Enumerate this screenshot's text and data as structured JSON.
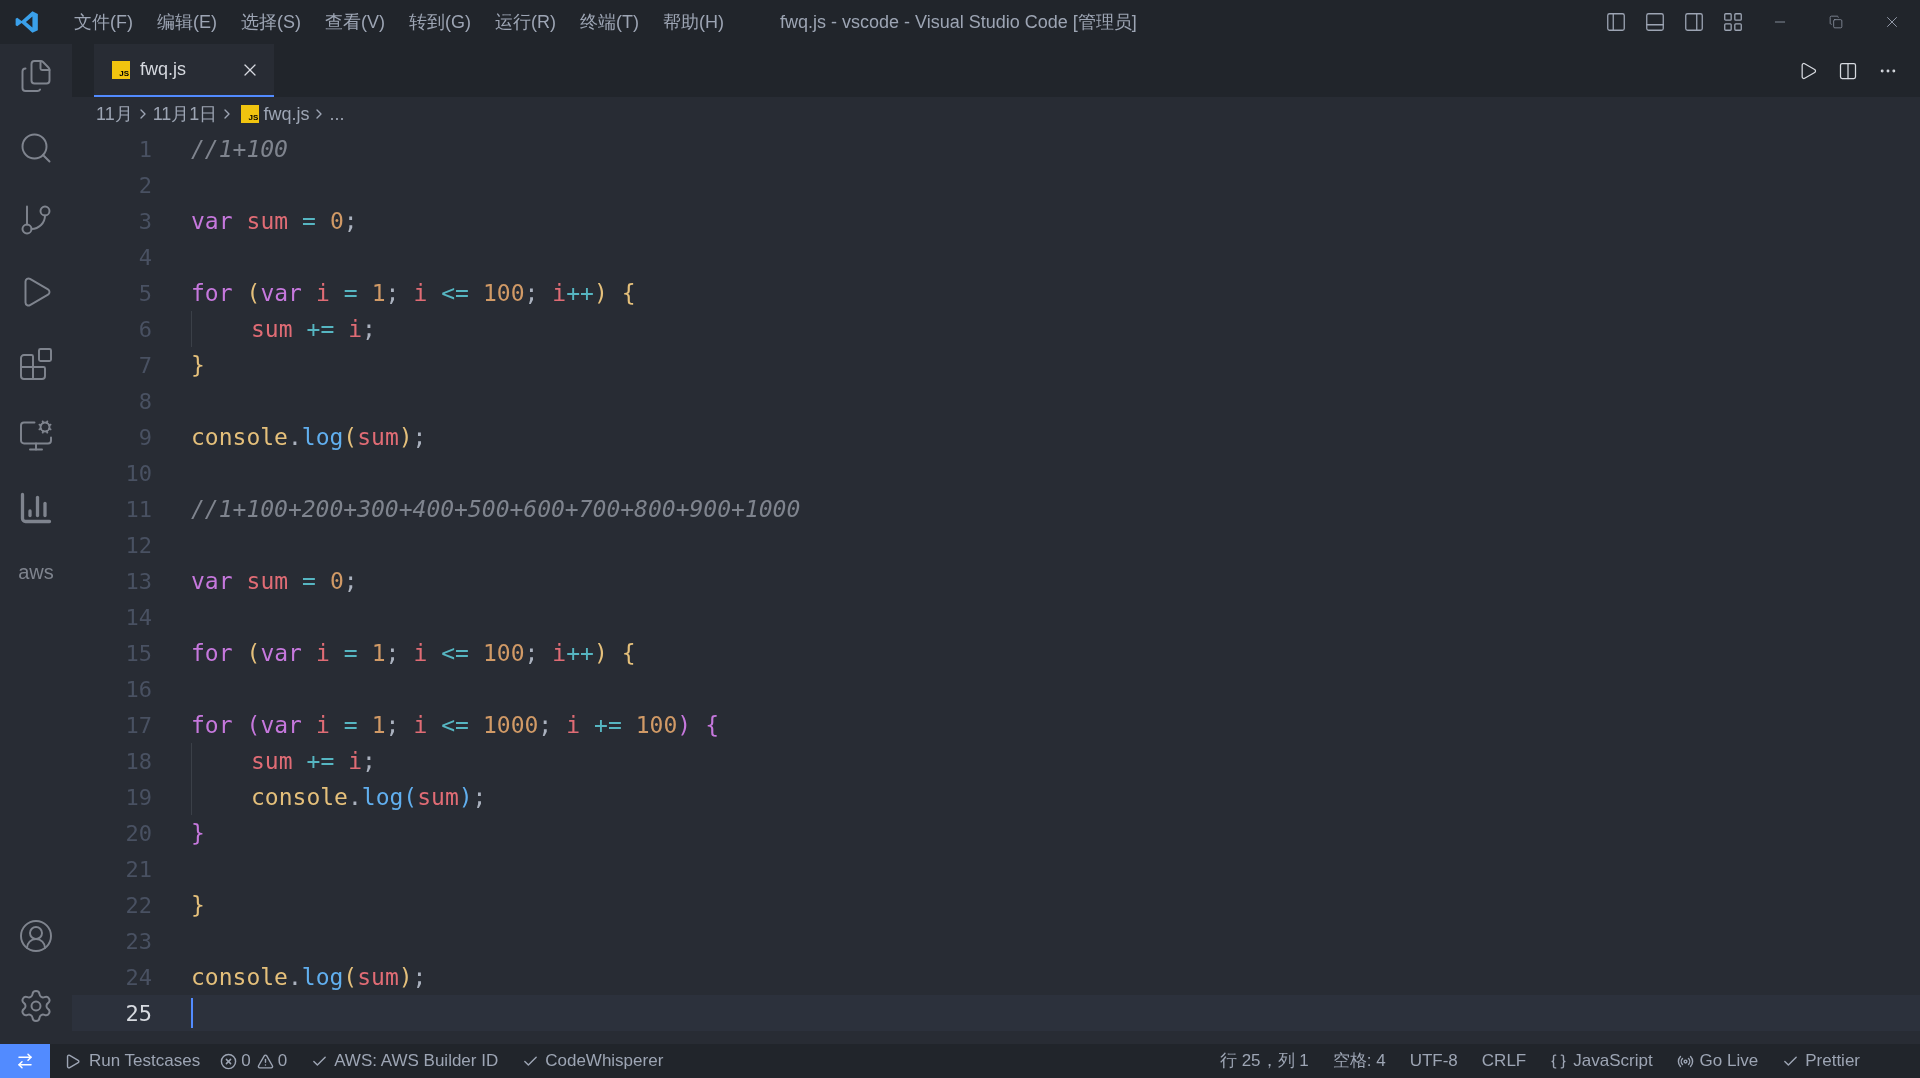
{
  "title_bar": {
    "menus": [
      "文件(F)",
      "编辑(E)",
      "选择(S)",
      "查看(V)",
      "转到(G)",
      "运行(R)",
      "终端(T)",
      "帮助(H)"
    ],
    "title": "fwq.js - vscode - Visual Studio Code [管理员]"
  },
  "activity_bar": {
    "items": [
      {
        "kind": "files",
        "selected": false
      },
      {
        "kind": "search",
        "selected": false
      },
      {
        "kind": "git",
        "selected": false
      },
      {
        "kind": "debug",
        "selected": false
      },
      {
        "kind": "extensions",
        "selected": false
      },
      {
        "kind": "remote",
        "selected": false
      },
      {
        "kind": "chart",
        "selected": false
      },
      {
        "kind": "aws",
        "selected": false
      }
    ],
    "aws_label": "aws"
  },
  "tabs": [
    {
      "badge": "JS",
      "label": "fwq.js",
      "selected": true
    }
  ],
  "breadcrumbs": [
    {
      "label": "11月"
    },
    {
      "label": "11月1日"
    },
    {
      "label": "fwq.js",
      "badge": "JS"
    },
    {
      "label": "..."
    }
  ],
  "editor": {
    "lines": [
      {
        "number": "1",
        "current": false,
        "tokens": [
          {
            "kind": "comment",
            "text": "//1+100"
          }
        ]
      },
      {
        "number": "2",
        "current": false
      },
      {
        "number": "3",
        "current": false,
        "tokens": [
          {
            "kind": "kw",
            "text": "var"
          },
          {
            "kind": "var",
            "text": "sum"
          },
          {
            "kind": "op",
            "text": "="
          },
          {
            "kind": "num",
            "text": "0"
          },
          {
            "kind": "punc",
            "text": ";"
          }
        ]
      },
      {
        "number": "4",
        "current": false
      },
      {
        "number": "5",
        "current": false,
        "tokens": [
          {
            "kind": "kw",
            "text": "for"
          },
          {
            "kind": "b1",
            "text": "("
          },
          {
            "kind": "kw",
            "text": "var"
          },
          {
            "kind": "var",
            "text": "i"
          },
          {
            "kind": "op",
            "text": "="
          },
          {
            "kind": "num",
            "text": "1"
          },
          {
            "kind": "punc",
            "text": ";"
          },
          {
            "kind": "var",
            "text": "i"
          },
          {
            "kind": "op",
            "text": "<="
          },
          {
            "kind": "num",
            "text": "100"
          },
          {
            "kind": "punc",
            "text": ";"
          },
          {
            "kind": "var",
            "text": "i"
          },
          {
            "kind": "op",
            "text": "++"
          },
          {
            "kind": "b1",
            "text": ")"
          },
          {
            "kind": "b1",
            "text": "{"
          }
        ]
      },
      {
        "number": "6",
        "current": false,
        "indent": true,
        "tokens": [
          {
            "kind": "var",
            "text": "sum"
          },
          {
            "kind": "op",
            "text": "+="
          },
          {
            "kind": "var",
            "text": "i"
          },
          {
            "kind": "punc",
            "text": ";"
          }
        ]
      },
      {
        "number": "7",
        "current": false,
        "tokens": [
          {
            "kind": "b1",
            "text": "}"
          }
        ]
      },
      {
        "number": "8",
        "current": false
      },
      {
        "number": "9",
        "current": false,
        "tokens": [
          {
            "kind": "obj",
            "text": "console"
          },
          {
            "kind": "punc",
            "text": "."
          },
          {
            "kind": "fn",
            "text": "log"
          },
          {
            "kind": "b1",
            "text": "("
          },
          {
            "kind": "var",
            "text": "sum"
          },
          {
            "kind": "b1",
            "text": ")"
          },
          {
            "kind": "punc",
            "text": ";"
          }
        ]
      },
      {
        "number": "10",
        "current": false
      },
      {
        "number": "11",
        "current": false,
        "tokens": [
          {
            "kind": "comment",
            "text": "//1+100+200+300+400+500+600+700+800+900+1000"
          }
        ]
      },
      {
        "number": "12",
        "current": false
      },
      {
        "number": "13",
        "current": false,
        "tokens": [
          {
            "kind": "kw",
            "text": "var"
          },
          {
            "kind": "var",
            "text": "sum"
          },
          {
            "kind": "op",
            "text": "="
          },
          {
            "kind": "num",
            "text": "0"
          },
          {
            "kind": "punc",
            "text": ";"
          }
        ]
      },
      {
        "number": "14",
        "current": false
      },
      {
        "number": "15",
        "current": false,
        "tokens": [
          {
            "kind": "kw",
            "text": "for"
          },
          {
            "kind": "b1",
            "text": "("
          },
          {
            "kind": "kw",
            "text": "var"
          },
          {
            "kind": "var",
            "text": "i"
          },
          {
            "kind": "op",
            "text": "="
          },
          {
            "kind": "num",
            "text": "1"
          },
          {
            "kind": "punc",
            "text": ";"
          },
          {
            "kind": "var",
            "text": "i"
          },
          {
            "kind": "op",
            "text": "<="
          },
          {
            "kind": "num",
            "text": "100"
          },
          {
            "kind": "punc",
            "text": ";"
          },
          {
            "kind": "var",
            "text": "i"
          },
          {
            "kind": "op",
            "text": "++"
          },
          {
            "kind": "b1",
            "text": ")"
          },
          {
            "kind": "b1",
            "text": "{"
          }
        ]
      },
      {
        "number": "16",
        "current": false
      },
      {
        "number": "17",
        "current": false,
        "tokens": [
          {
            "kind": "kw",
            "text": "for"
          },
          {
            "kind": "b2",
            "text": "("
          },
          {
            "kind": "kw",
            "text": "var"
          },
          {
            "kind": "var",
            "text": "i"
          },
          {
            "kind": "op",
            "text": "="
          },
          {
            "kind": "num",
            "text": "1"
          },
          {
            "kind": "punc",
            "text": ";"
          },
          {
            "kind": "var",
            "text": "i"
          },
          {
            "kind": "op",
            "text": "<="
          },
          {
            "kind": "num",
            "text": "1000"
          },
          {
            "kind": "punc",
            "text": ";"
          },
          {
            "kind": "var",
            "text": "i"
          },
          {
            "kind": "op",
            "text": "+="
          },
          {
            "kind": "num",
            "text": "100"
          },
          {
            "kind": "b2",
            "text": ")"
          },
          {
            "kind": "b2",
            "text": "{"
          }
        ]
      },
      {
        "number": "18",
        "current": false,
        "indent": true,
        "tokens": [
          {
            "kind": "var",
            "text": "sum"
          },
          {
            "kind": "op",
            "text": "+="
          },
          {
            "kind": "var",
            "text": "i"
          },
          {
            "kind": "punc",
            "text": ";"
          }
        ]
      },
      {
        "number": "19",
        "current": false,
        "indent": true,
        "tokens": [
          {
            "kind": "obj",
            "text": "console"
          },
          {
            "kind": "punc",
            "text": "."
          },
          {
            "kind": "fn",
            "text": "log"
          },
          {
            "kind": "b3",
            "text": "("
          },
          {
            "kind": "var",
            "text": "sum"
          },
          {
            "kind": "b3",
            "text": ")"
          },
          {
            "kind": "punc",
            "text": ";"
          }
        ]
      },
      {
        "number": "20",
        "current": false,
        "tokens": [
          {
            "kind": "b2",
            "text": "}"
          }
        ]
      },
      {
        "number": "21",
        "current": false
      },
      {
        "number": "22",
        "current": false,
        "tokens": [
          {
            "kind": "b1",
            "text": "}"
          }
        ]
      },
      {
        "number": "23",
        "current": false
      },
      {
        "number": "24",
        "current": false,
        "tokens": [
          {
            "kind": "obj",
            "text": "console"
          },
          {
            "kind": "punc",
            "text": "."
          },
          {
            "kind": "fn",
            "text": "log"
          },
          {
            "kind": "b1",
            "text": "("
          },
          {
            "kind": "var",
            "text": "sum"
          },
          {
            "kind": "b1",
            "text": ")"
          },
          {
            "kind": "punc",
            "text": ";"
          }
        ]
      },
      {
        "number": "25",
        "current": true
      }
    ]
  },
  "status_bar": {
    "left": [
      {
        "kind": "run",
        "label": "Run Testcases"
      },
      {
        "kind": "problems",
        "errors": "0",
        "warnings": "0"
      },
      {
        "kind": "check",
        "label": "AWS: AWS Builder ID"
      },
      {
        "kind": "check",
        "label": "CodeWhisperer"
      }
    ],
    "right": [
      {
        "kind": "text",
        "label": "行 25，列 1"
      },
      {
        "kind": "text",
        "label": "空格: 4"
      },
      {
        "kind": "text",
        "label": "UTF-8"
      },
      {
        "kind": "text",
        "label": "CRLF"
      },
      {
        "kind": "lang",
        "label": "JavaScript"
      },
      {
        "kind": "live",
        "label": "Go Live"
      },
      {
        "kind": "check",
        "label": "Prettier"
      }
    ]
  }
}
